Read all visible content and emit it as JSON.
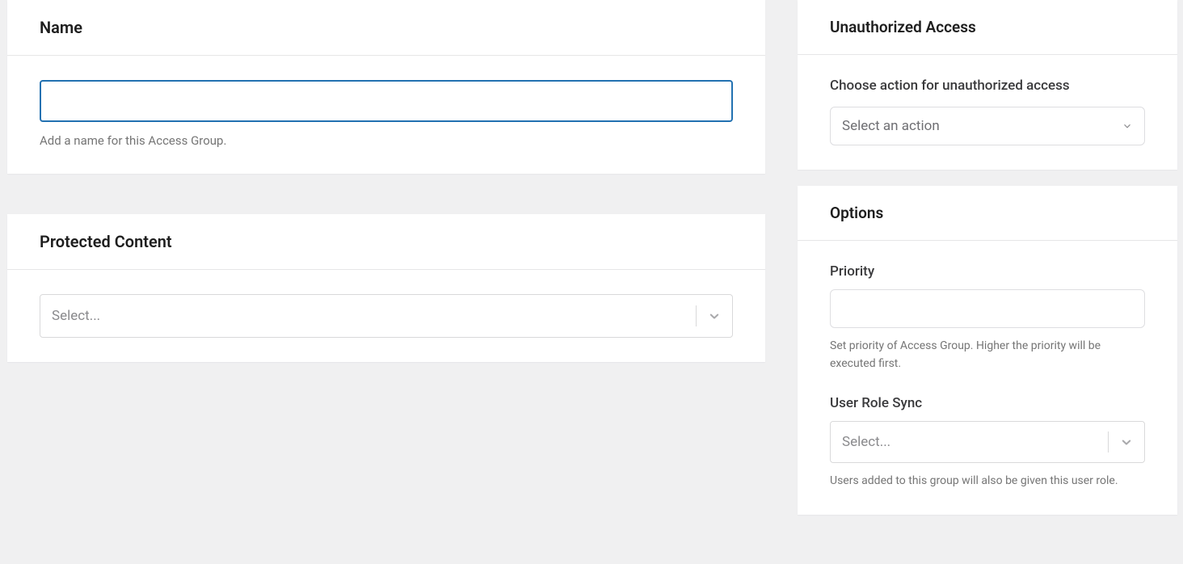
{
  "name_card": {
    "title": "Name",
    "input_value": "",
    "help": "Add a name for this Access Group."
  },
  "protected_card": {
    "title": "Protected Content",
    "select_placeholder": "Select..."
  },
  "unauthorized_card": {
    "title": "Unauthorized Access",
    "label": "Choose action for unauthorized access",
    "select_placeholder": "Select an action"
  },
  "options_card": {
    "title": "Options",
    "priority": {
      "label": "Priority",
      "value": "",
      "help": "Set priority of Access Group. Higher the priority will be executed first."
    },
    "role_sync": {
      "label": "User Role Sync",
      "select_placeholder": "Select...",
      "help": "Users added to this group will also be given this user role."
    }
  }
}
